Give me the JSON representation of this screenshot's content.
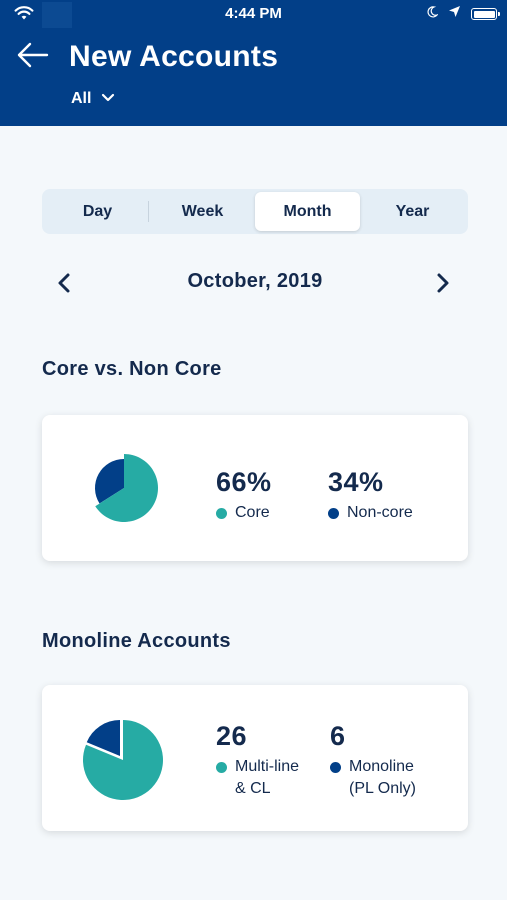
{
  "status_bar": {
    "time": "4:44 PM",
    "icons": [
      "wifi-icon",
      "moon-icon",
      "location-arrow-icon",
      "battery-icon"
    ]
  },
  "header": {
    "title": "New Accounts",
    "filter_label": "All",
    "back_icon": "arrow-left-icon",
    "filter_icon": "chevron-down-icon"
  },
  "period_tabs": {
    "items": [
      "Day",
      "Week",
      "Month",
      "Year"
    ],
    "selected": "Month"
  },
  "date_nav": {
    "label": "October, 2019",
    "prev_icon": "chevron-left-icon",
    "next_icon": "chevron-right-icon"
  },
  "sections": [
    {
      "title": "Core vs. Non Core",
      "stats": [
        {
          "value": "66%",
          "label": "Core",
          "color": "#26aba4"
        },
        {
          "value": "34%",
          "label": "Non-core",
          "color": "#023f88"
        }
      ],
      "pie": {
        "primary_fraction": 0.66,
        "secondary_fraction": 0.34
      }
    },
    {
      "title": "Monoline Accounts",
      "stats": [
        {
          "value": "26",
          "label_lines": [
            "Multi-line",
            "& CL"
          ],
          "color": "#26aba4"
        },
        {
          "value": "6",
          "label_lines": [
            "Monoline",
            "(PL Only)"
          ],
          "color": "#023f88"
        }
      ],
      "pie": {
        "primary_value": 26,
        "secondary_value": 6
      }
    }
  ],
  "colors": {
    "header_bg": "#023f88",
    "accent_teal": "#26aba4",
    "accent_navy": "#023f88",
    "text_dark": "#142a4d",
    "page_bg": "#f4f8fb"
  }
}
